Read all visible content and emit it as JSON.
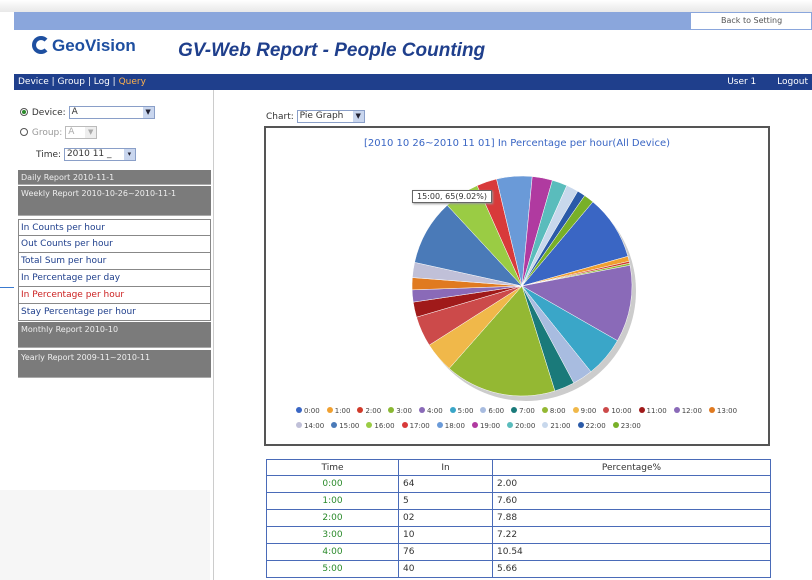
{
  "app": {
    "back_button": "Back to Setting",
    "logo_text": "GeoVision",
    "title": "GV-Web Report - People Counting"
  },
  "nav": {
    "items": [
      "Device",
      "Group",
      "Log",
      "Query"
    ],
    "active_index": 3,
    "user": "User 1",
    "logout": "Logout"
  },
  "filters": {
    "device_label": "Device:",
    "device_value": "A",
    "group_label": "Group:",
    "group_value": "A",
    "time_label": "Time:",
    "time_value": "2010 11 _"
  },
  "sidebar": {
    "daily_report": "Daily Report 2010-11-1",
    "weekly_report": "Weekly Report 2010-10-26~2010-11-1",
    "weekly_items": [
      "In Counts per hour",
      "Out Counts per hour",
      "Total Sum per hour",
      "In Percentage per day",
      "In Percentage per hour",
      "Stay Percentage per hour"
    ],
    "active_item_index": 4,
    "monthly_report": "Monthly Report 2010-10",
    "yearly_report": "Yearly Report 2009-11~2010-11"
  },
  "chart_controls": {
    "label": "Chart:",
    "value": "Pie Graph"
  },
  "chart_data": {
    "type": "pie",
    "title": "[2010 10 26~2010 11 01] In Percentage per hour(All Device)",
    "tooltip": "15:00, 65(9.02%)",
    "categories": [
      "0:00",
      "1:00",
      "2:00",
      "3:00",
      "4:00",
      "5:00",
      "6:00",
      "7:00",
      "8:00",
      "9:00",
      "10:00",
      "11:00",
      "12:00",
      "13:00",
      "14:00",
      "15:00",
      "16:00",
      "17:00",
      "18:00",
      "19:00",
      "20:00",
      "21:00",
      "22:00",
      "23:00"
    ],
    "values": [
      64,
      5,
      2,
      2,
      76,
      40,
      20,
      20,
      110,
      30,
      30,
      15,
      12,
      12,
      15,
      65,
      35,
      20,
      35,
      20,
      15,
      12,
      8,
      10
    ],
    "colors": [
      "#3a66c4",
      "#f0a030",
      "#d03a2a",
      "#8ab833",
      "#8a6ab8",
      "#3aa6c8",
      "#a8bce0",
      "#1a7a7a",
      "#94b833",
      "#f0b84a",
      "#cc4a4a",
      "#a01a1a",
      "#8a6ab8",
      "#e07a20",
      "#c0c0d8",
      "#4a7ab8",
      "#9acc44",
      "#d83a3a",
      "#6a9ad8",
      "#b03aa0",
      "#5abcbc",
      "#c8d8ec",
      "#2a5aa8",
      "#78b028"
    ]
  },
  "legend": {
    "labels": [
      "0:00",
      "1:00",
      "2:00",
      "3:00",
      "4:00",
      "5:00",
      "6:00",
      "7:00",
      "8:00",
      "9:00",
      "10:00",
      "11:00",
      "12:00",
      "13:00",
      "14:00",
      "15:00",
      "16:00",
      "17:00",
      "18:00",
      "19:00",
      "20:00",
      "21:00",
      "22:00",
      "23:00"
    ]
  },
  "table": {
    "headers": [
      "Time",
      "In",
      "Percentage%"
    ],
    "rows": [
      [
        "0:00",
        "64",
        "2.00"
      ],
      [
        "1:00",
        "5",
        "7.60"
      ],
      [
        "2:00",
        "02",
        "7.88"
      ],
      [
        "3:00",
        "10",
        "7.22"
      ],
      [
        "4:00",
        "76",
        "10.54"
      ],
      [
        "5:00",
        "40",
        "5.66"
      ]
    ]
  }
}
